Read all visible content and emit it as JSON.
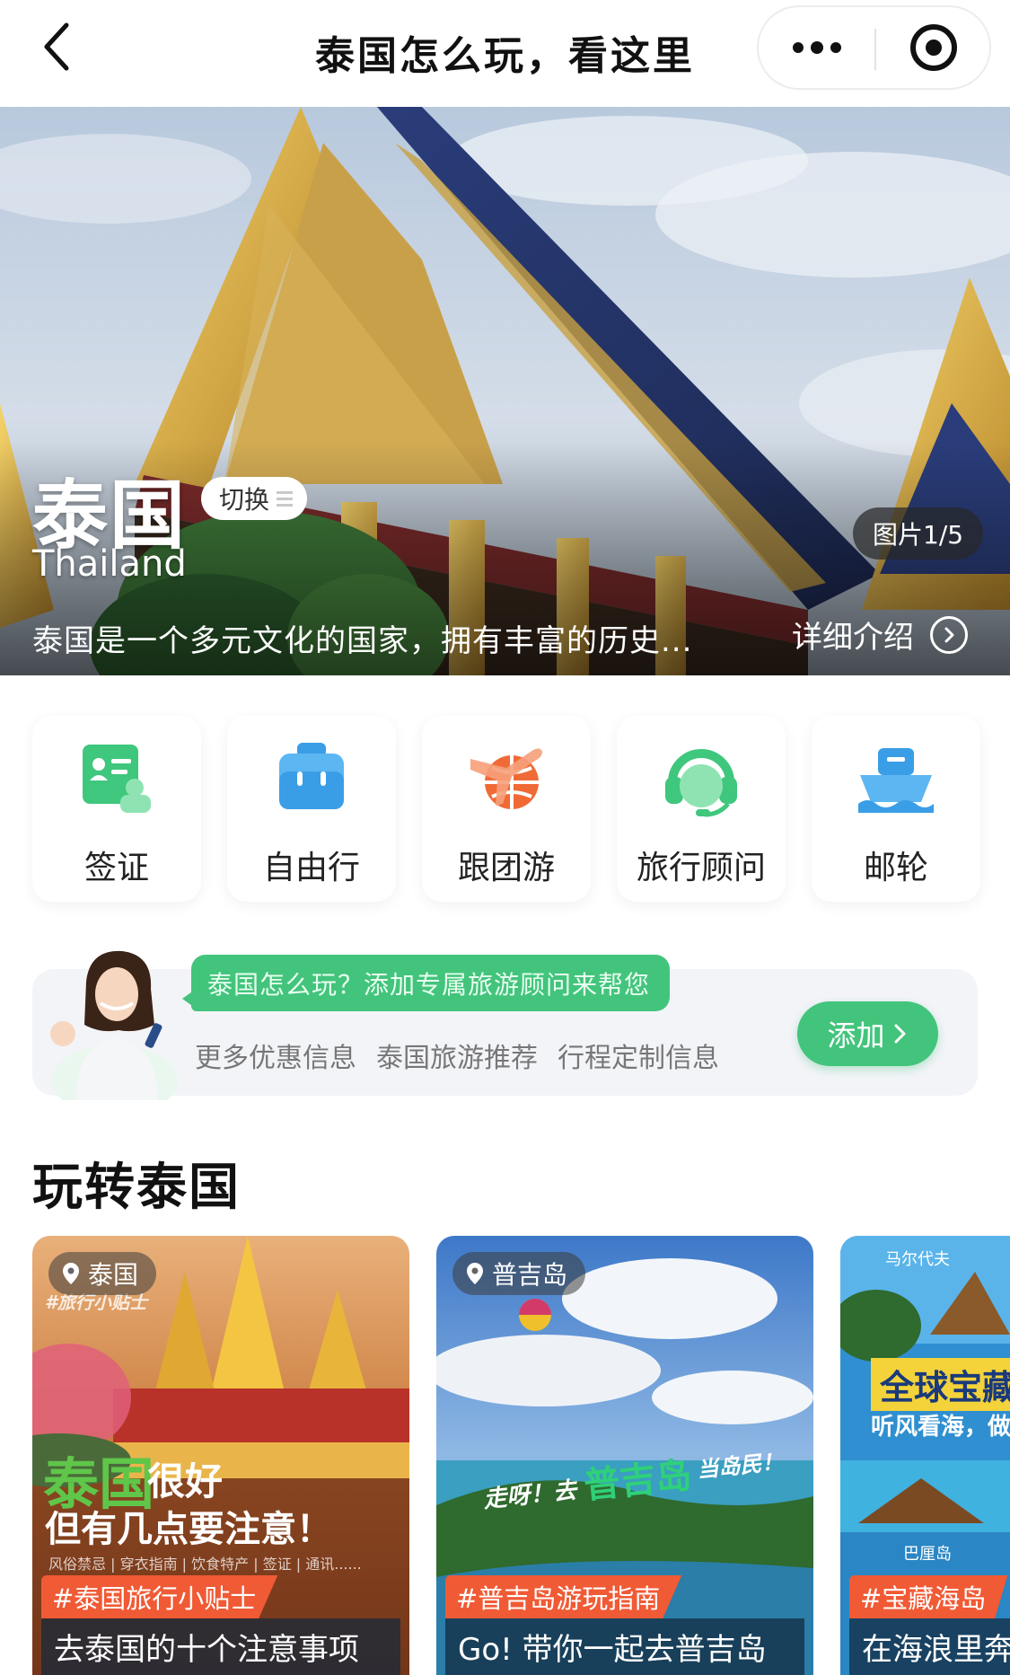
{
  "nav": {
    "title": "泰国怎么玩，看这里"
  },
  "hero": {
    "name": "泰国",
    "name_en": "Thailand",
    "switch_label": "切换",
    "photo_count": "图片1/5",
    "description": "泰国是一个多元文化的国家，拥有丰富的历史...",
    "detail_label": "详细介绍"
  },
  "categories": [
    {
      "label": "签证",
      "icon": "visa-card-icon",
      "color": "#3fc77d"
    },
    {
      "label": "自由行",
      "icon": "backpack-icon",
      "color": "#3a9ee6"
    },
    {
      "label": "跟团游",
      "icon": "plane-globe-icon",
      "color": "#f06a35"
    },
    {
      "label": "旅行顾问",
      "icon": "headset-icon",
      "color": "#3fc77d"
    },
    {
      "label": "邮轮",
      "icon": "cruise-ship-icon",
      "color": "#3a9ee6"
    }
  ],
  "advisor": {
    "tag": "泰国怎么玩？添加专属旅游顾问来帮您",
    "items": [
      "更多优惠信息",
      "泰国旅游推荐",
      "行程定制信息"
    ],
    "button_label": "添加"
  },
  "section": {
    "title": "玩转泰国"
  },
  "articles": [
    {
      "location": "泰国",
      "poster_tag": "#旅行小贴士",
      "poster_big": "泰国",
      "poster_line1": "很好",
      "poster_line2": "但有几点要注意！",
      "poster_small": "风俗禁忌 | 穿衣指南 | 饮食特产 | 签证 | 通讯......",
      "hashtag": "#泰国旅行小贴士",
      "title": "去泰国的十个注意事项"
    },
    {
      "location": "普吉岛",
      "poster_line1": "走呀！去",
      "poster_big": "普吉岛",
      "poster_line2": "当岛民！",
      "hashtag": "#普吉岛游玩指南",
      "title": "Go! 带你一起去普吉岛"
    },
    {
      "poster_top": "马尔代夫",
      "poster_big": "全球宝藏",
      "poster_line1": "听风看海，做",
      "poster_bottom": "巴厘岛",
      "hashtag": "#宝藏海岛",
      "title": "在海浪里奔"
    }
  ]
}
